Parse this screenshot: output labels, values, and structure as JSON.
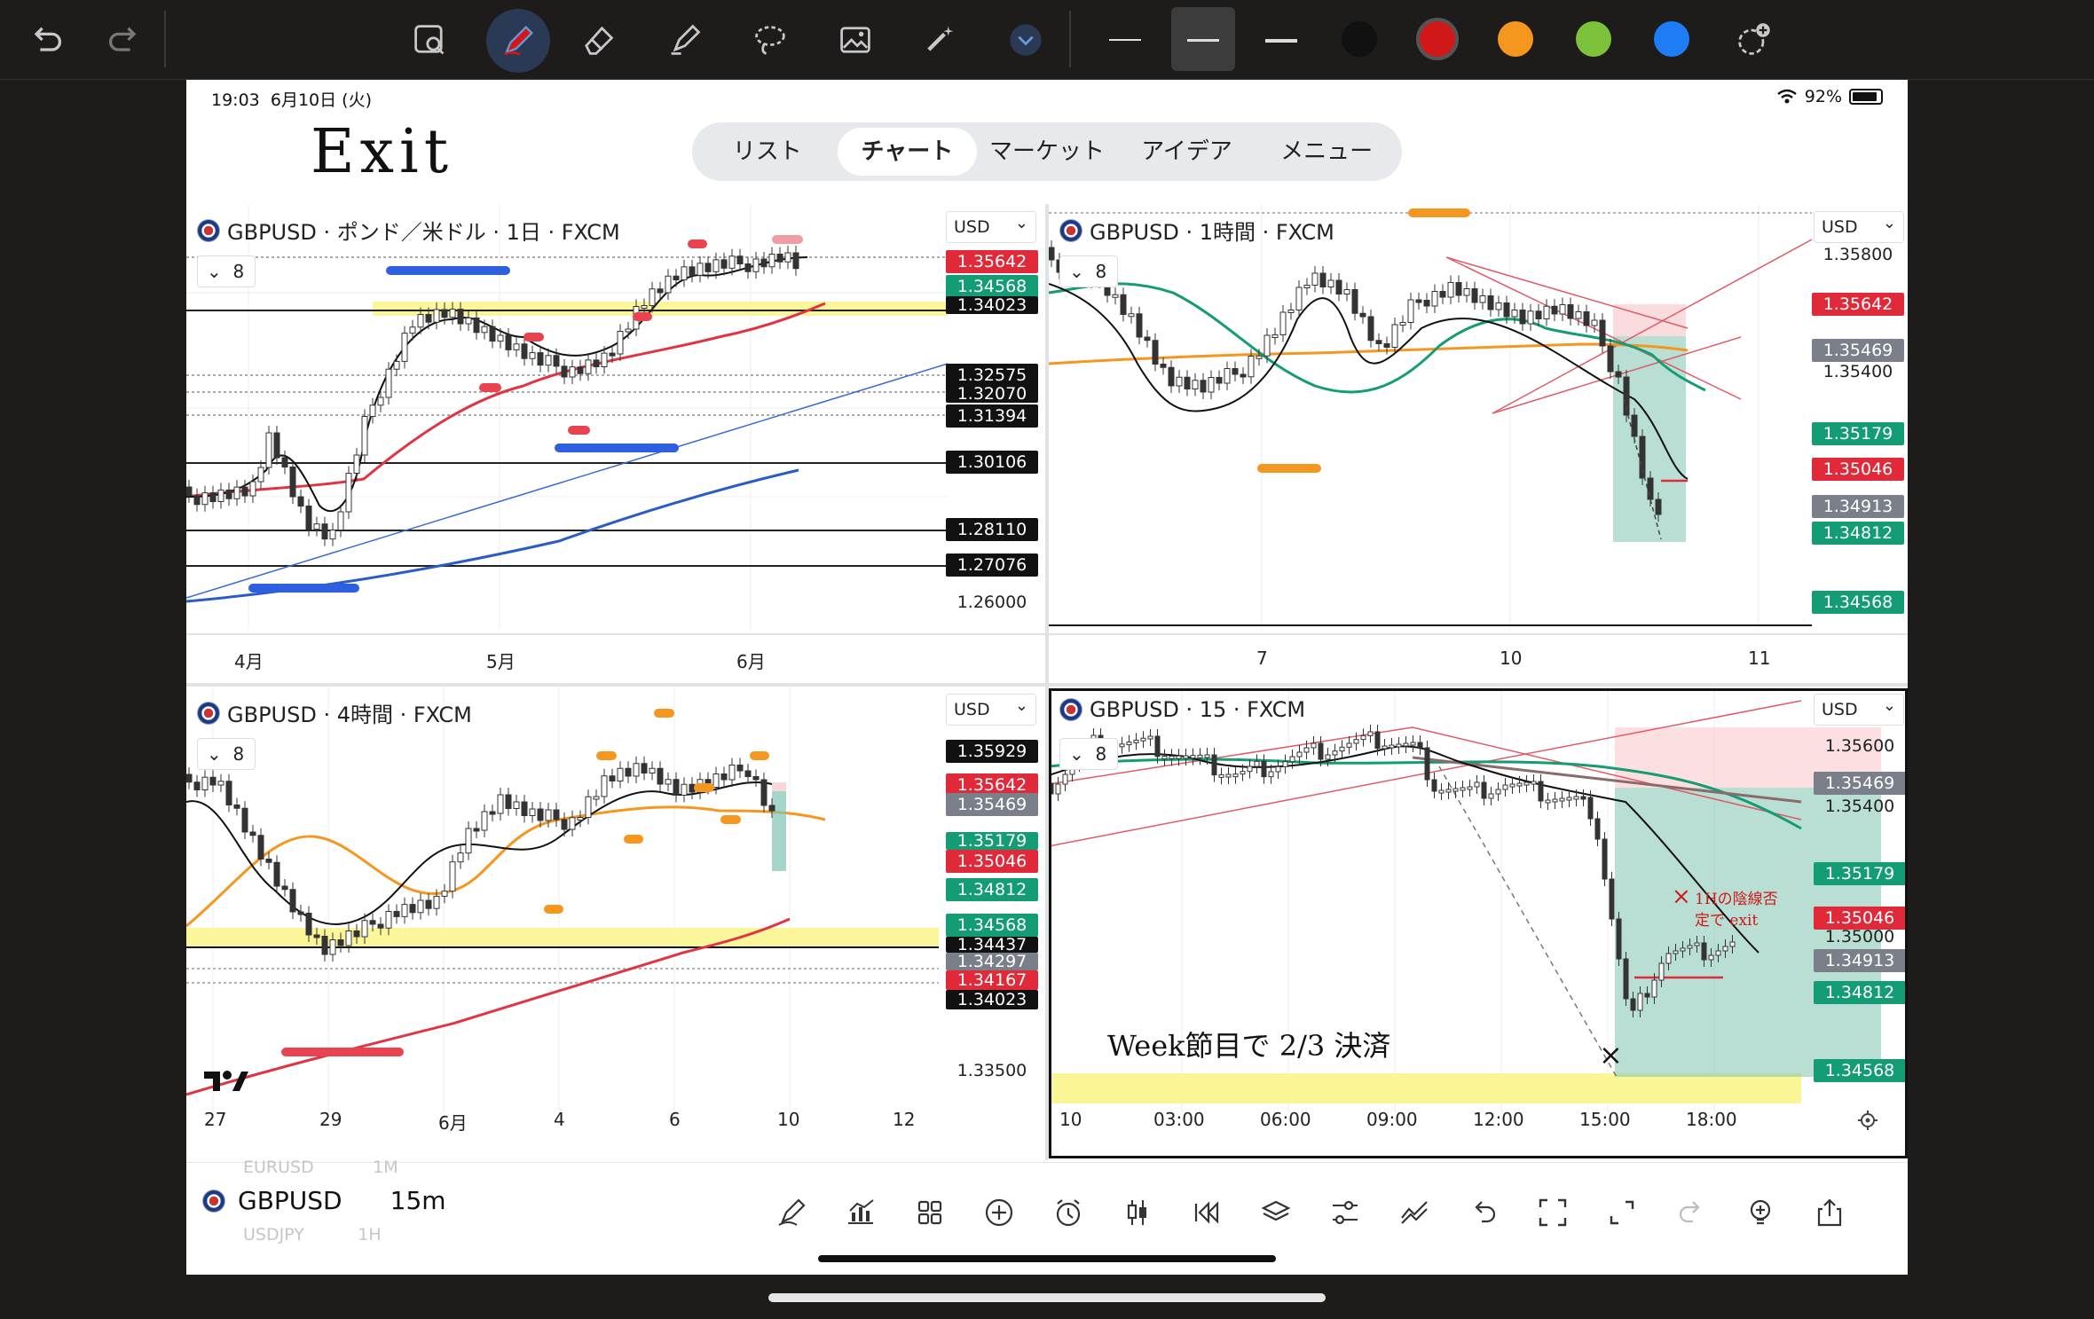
{
  "toolbar": {
    "undo_icon": "undo-arrow-icon",
    "redo_icon": "redo-arrow-icon",
    "colors": [
      "#111111",
      "#d01818",
      "#f5961e",
      "#7cc23a",
      "#1e7cf5"
    ]
  },
  "status": {
    "time": "19:03",
    "date": "6月10日 (火)",
    "battery": "92%"
  },
  "handwriting": {
    "title": "Exit",
    "note_week": "Week節目で 2/3 決済",
    "note_1h": "1Hの陰線否定で exit",
    "x_mark": "×"
  },
  "tabs": [
    "リスト",
    "チャート",
    "マーケット",
    "アイデア",
    "メニュー"
  ],
  "panels": {
    "daily": {
      "title": "GBPUSD · ポンド／米ドル · 1日 · FXCM",
      "currency": "USD",
      "indicator": "8",
      "prices": [
        "1.35642",
        "1.34568",
        "1.34023",
        "1.32575",
        "1.32070",
        "1.31394",
        "1.30106",
        "1.28110",
        "1.27076",
        "1.26000"
      ],
      "xaxis": [
        "4月",
        "5月",
        "6月"
      ]
    },
    "h1": {
      "title": "GBPUSD · 1時間 · FXCM",
      "currency": "USD",
      "indicator": "8",
      "prices": [
        "1.35800",
        "1.35642",
        "1.35469",
        "1.35400",
        "1.35179",
        "1.35046",
        "1.34913",
        "1.34812",
        "1.34568"
      ],
      "xaxis": [
        "7",
        "10",
        "11"
      ]
    },
    "h4": {
      "title": "GBPUSD · 4時間 · FXCM",
      "currency": "USD",
      "indicator": "8",
      "prices": [
        "1.35929",
        "1.35642",
        "1.35469",
        "1.35179",
        "1.35046",
        "1.34812",
        "1.34568",
        "1.34437",
        "1.34297",
        "1.34167",
        "1.34023",
        "1.33500"
      ],
      "xaxis": [
        "27",
        "29",
        "6月",
        "4",
        "6",
        "10",
        "12"
      ]
    },
    "m15": {
      "title": "GBPUSD · 15 · FXCM",
      "currency": "USD",
      "indicator": "8",
      "prices": [
        "1.35600",
        "1.35469",
        "1.35400",
        "1.35179",
        "1.35046",
        "1.35000",
        "1.34913",
        "1.34812",
        "1.34568"
      ],
      "xaxis": [
        "10",
        "03:00",
        "06:00",
        "09:00",
        "12:00",
        "15:00",
        "18:00"
      ]
    }
  },
  "bottom": {
    "symbol": "GBPUSD",
    "timeframe": "15m",
    "ghost_above": "EURUSD",
    "ghost_above_tf": "1M",
    "ghost_below": "USDJPY",
    "ghost_below_tf": "1H"
  }
}
